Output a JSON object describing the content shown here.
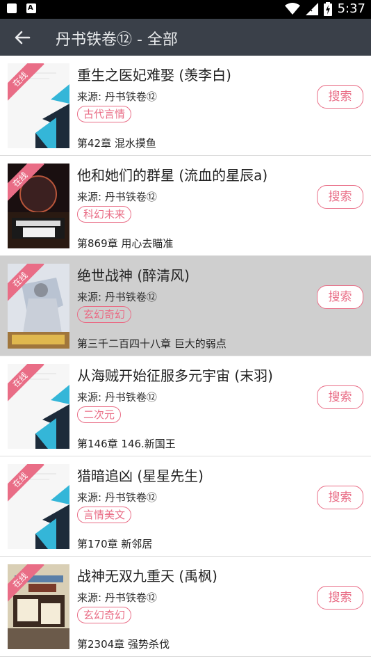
{
  "status_bar": {
    "time": "5:37",
    "icons": [
      "notification-icon",
      "font-app-icon",
      "wifi-icon",
      "signal-icon",
      "battery-icon"
    ]
  },
  "toolbar": {
    "title": "丹书铁卷⑫ - 全部",
    "back_icon": "back-arrow-icon"
  },
  "colors": {
    "toolbar_bg": "#3a4049",
    "accent_pink": "#e96d86",
    "highlight_row": "#cfcfcf"
  },
  "common": {
    "ribbon_label": "在线",
    "search_label": "搜索"
  },
  "books": [
    {
      "title": "重生之医妃难娶 (羡李白)",
      "source": "来源: 丹书铁卷⑫",
      "tag": "古代言情",
      "chapter": "第42章 混水摸鱼",
      "cover": "default",
      "highlighted": false
    },
    {
      "title": "他和她们的群星 (流血的星辰a)",
      "source": "来源: 丹书铁卷⑫",
      "tag": "科幻未来",
      "chapter": "第869章 用心去瞄准",
      "cover": "space",
      "highlighted": false
    },
    {
      "title": "绝世战神 (醉清风)",
      "source": "来源: 丹书铁卷⑫",
      "tag": "玄幻奇幻",
      "chapter": "第三千二百四十八章 巨大的弱点",
      "cover": "warrior",
      "highlighted": true
    },
    {
      "title": "从海贼开始征服多元宇宙 (末羽)",
      "source": "来源: 丹书铁卷⑫",
      "tag": "二次元",
      "chapter": "第146章 146.新国王",
      "cover": "default",
      "highlighted": false
    },
    {
      "title": "猎暗追凶 (星星先生)",
      "source": "来源: 丹书铁卷⑫",
      "tag": "言情美文",
      "chapter": "第170章 新邻居",
      "cover": "default",
      "highlighted": false
    },
    {
      "title": "战神无双九重天 (禹枫)",
      "source": "来源: 丹书铁卷⑫",
      "tag": "玄幻奇幻",
      "chapter": "第2304章 强势杀伐",
      "cover": "fantasy",
      "highlighted": false
    }
  ]
}
